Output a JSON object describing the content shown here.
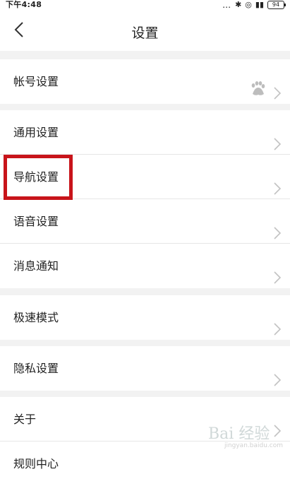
{
  "status_bar": {
    "time": "下午4:48",
    "icons": [
      "more-dots",
      "bluetooth",
      "alarm",
      "signal"
    ],
    "battery": "94"
  },
  "header": {
    "title": "设置"
  },
  "groups": [
    {
      "items": [
        {
          "label": "帐号设置",
          "has_avatar": true
        }
      ]
    },
    {
      "items": [
        {
          "label": "通用设置"
        },
        {
          "label": "导航设置",
          "highlighted": true
        },
        {
          "label": "语音设置"
        },
        {
          "label": "消息通知"
        }
      ]
    },
    {
      "items": [
        {
          "label": "极速模式"
        }
      ]
    },
    {
      "items": [
        {
          "label": "隐私设置"
        }
      ]
    },
    {
      "items": [
        {
          "label": "关于"
        },
        {
          "label": "规则中心"
        }
      ]
    }
  ],
  "colors": {
    "highlight_border": "#c8141a",
    "background": "#f2f2f2",
    "row_background": "#ffffff"
  },
  "watermark": {
    "text": "Bai 经验",
    "url": "jingyan.baidu.com"
  }
}
